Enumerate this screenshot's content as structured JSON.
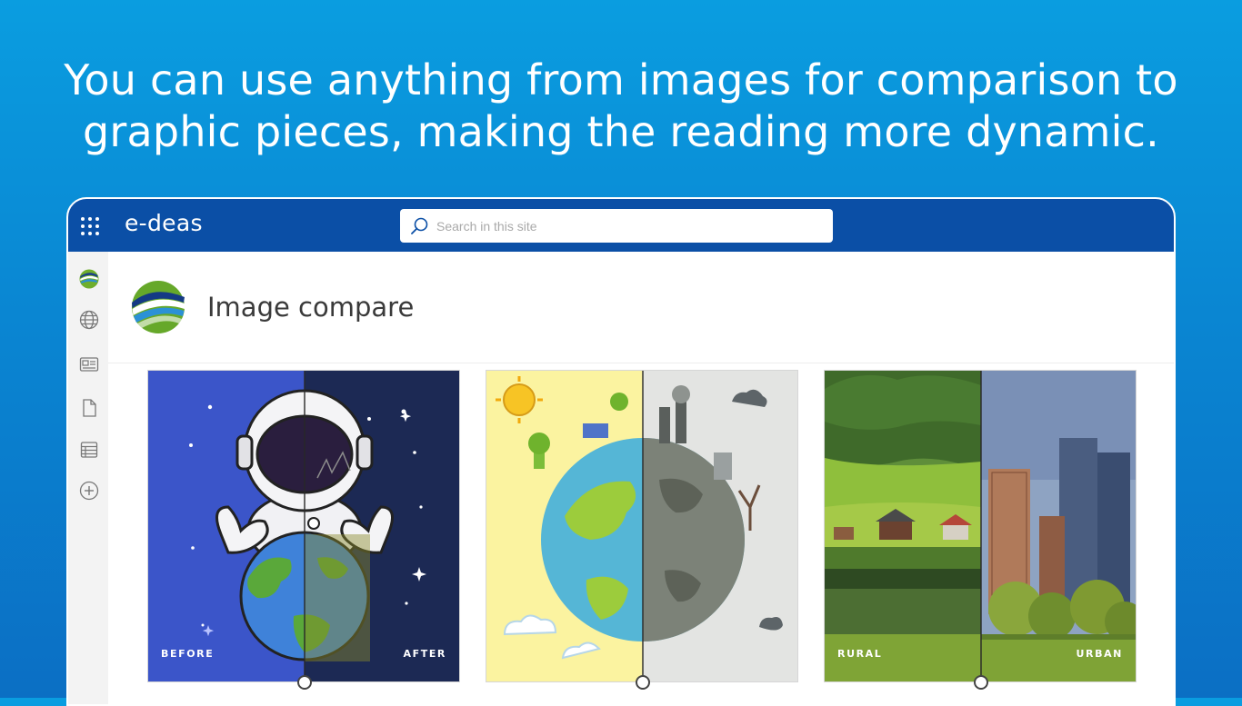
{
  "headline": {
    "line1": "You can use anything from images for comparison to",
    "line2": "graphic pieces, making the reading more dynamic."
  },
  "app": {
    "brand": "e-deas",
    "search_placeholder": "Search in this site",
    "colors": {
      "topbar": "#0b4fa6",
      "background_top": "#0a9de0",
      "background_bottom": "#0b6fc4",
      "rail": "#f3f3f3"
    }
  },
  "leftrail": {
    "icons": [
      "site-logo-icon",
      "globe-icon",
      "news-icon",
      "document-icon",
      "list-icon",
      "add-icon"
    ]
  },
  "page": {
    "title": "Image compare"
  },
  "comparisons": [
    {
      "left_label": "BEFORE",
      "right_label": "AFTER",
      "split_percent": 50
    },
    {
      "left_label": "",
      "right_label": "",
      "split_percent": 50
    },
    {
      "left_label": "RURAL",
      "right_label": "URBAN",
      "split_percent": 50
    }
  ]
}
